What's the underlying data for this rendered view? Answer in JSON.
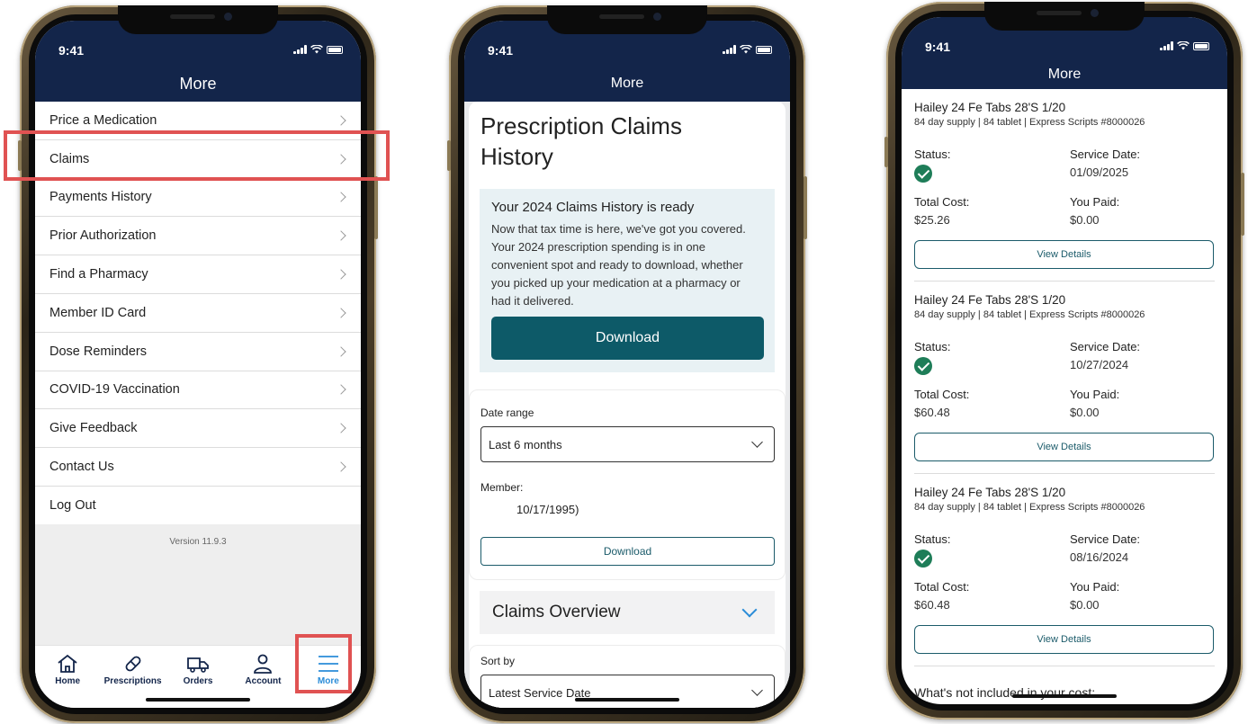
{
  "status_bar": {
    "time": "9:41"
  },
  "phone1": {
    "header_title": "More",
    "menu_items": [
      {
        "label": "Price a Medication"
      },
      {
        "label": "Claims"
      },
      {
        "label": "Payments History"
      },
      {
        "label": "Prior Authorization"
      },
      {
        "label": "Find a Pharmacy"
      },
      {
        "label": "Member ID Card"
      },
      {
        "label": "Dose Reminders"
      },
      {
        "label": "COVID-19 Vaccination"
      },
      {
        "label": "Give Feedback"
      },
      {
        "label": "Contact Us"
      },
      {
        "label": "Log Out"
      }
    ],
    "version": "Version 11.9.3",
    "tabs": [
      {
        "label": "Home",
        "icon": "home-icon"
      },
      {
        "label": "Prescriptions",
        "icon": "pill-icon"
      },
      {
        "label": "Orders",
        "icon": "truck-icon"
      },
      {
        "label": "Account",
        "icon": "person-icon"
      },
      {
        "label": "More",
        "icon": "hamburger-icon"
      }
    ],
    "highlight_color": "#e05252"
  },
  "phone2": {
    "header_title": "More",
    "page_title": "Prescription Claims History",
    "notice": {
      "title": "Your 2024 Claims History is ready",
      "body": "Now that tax time is here, we've got you covered. Your 2024 prescription spending is in one convenient spot and ready to download, whether you picked up your medication at a pharmacy or had it delivered.",
      "button": "Download"
    },
    "date_range": {
      "label": "Date range",
      "value": "Last 6 months"
    },
    "member": {
      "label": "Member:",
      "value": "10/17/1995)"
    },
    "download_outline": "Download",
    "claims_overview": "Claims Overview",
    "sort_by": {
      "label": "Sort by",
      "value": "Latest Service Date"
    },
    "primary_color": "#0d5a68"
  },
  "phone3": {
    "header_title": "More",
    "labels": {
      "status": "Status:",
      "service_date": "Service Date:",
      "total_cost": "Total Cost:",
      "you_paid": "You Paid:",
      "view_details": "View Details"
    },
    "claims": [
      {
        "name": "Hailey 24 Fe Tabs 28'S 1/20",
        "sub": "84 day supply | 84 tablet | Express Scripts #8000026",
        "service_date": "01/09/2025",
        "total_cost": "$25.26",
        "you_paid": "$0.00"
      },
      {
        "name": "Hailey 24 Fe Tabs 28'S 1/20",
        "sub": "84 day supply | 84 tablet | Express Scripts #8000026",
        "service_date": "10/27/2024",
        "total_cost": "$60.48",
        "you_paid": "$0.00"
      },
      {
        "name": "Hailey 24 Fe Tabs 28'S 1/20",
        "sub": "84 day supply | 84 tablet | Express Scripts #8000026",
        "service_date": "08/16/2024",
        "total_cost": "$60.48",
        "you_paid": "$0.00"
      }
    ],
    "footer_text": "What's not included in your cost:",
    "status_color": "#1e7d58"
  }
}
